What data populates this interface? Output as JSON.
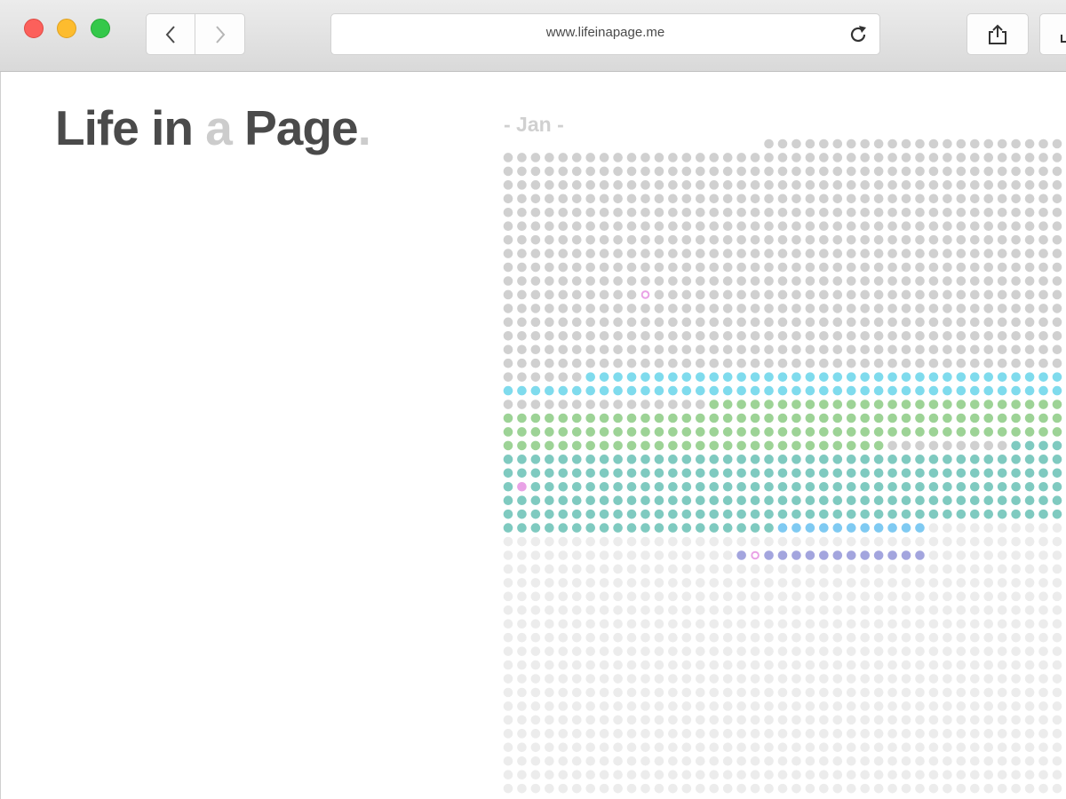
{
  "browser": {
    "url": "www.lifeinapage.me",
    "buttons": {
      "back": "chevron-left-icon",
      "forward": "chevron-right-icon",
      "reload": "reload-icon",
      "share": "share-icon"
    }
  },
  "page": {
    "logo": {
      "word1": "Life",
      "word2": "in",
      "word3": "a",
      "word4": "Page",
      "dot": "."
    },
    "month_label": "- Jan -"
  },
  "colors": {
    "grey": "#d0d0d0",
    "light": "#ececec",
    "cyan": "#7fdbed",
    "green": "#9dd396",
    "teal": "#7fcac0",
    "blue": "#7fcaf2",
    "violet": "#a3a5de",
    "pink": "#e9a2e6",
    "accent_light": "#cccccc",
    "text_dark": "#4a4a4a"
  },
  "dot_grid": {
    "columns": 42,
    "rows": 48,
    "first_filled_index_row0": 19,
    "runs": [
      {
        "color": "grey",
        "count": 701
      },
      {
        "color": "cyan",
        "count": 78
      },
      {
        "color": "grey",
        "count": 15
      },
      {
        "color": "green",
        "count": 139
      },
      {
        "color": "grey",
        "count": 9
      },
      {
        "color": "teal",
        "count": 235
      },
      {
        "color": "blue",
        "count": 11
      },
      {
        "color": "light",
        "count": 70
      },
      {
        "color": "violet",
        "count": 14
      },
      {
        "color": "light",
        "count": 725
      }
    ],
    "markers": [
      {
        "row": 11,
        "col": 10,
        "style": "ring",
        "color": "pink"
      },
      {
        "row": 25,
        "col": 1,
        "style": "dot",
        "color": "pink"
      },
      {
        "row": 30,
        "col": 18,
        "style": "ring",
        "color": "pink"
      }
    ]
  }
}
